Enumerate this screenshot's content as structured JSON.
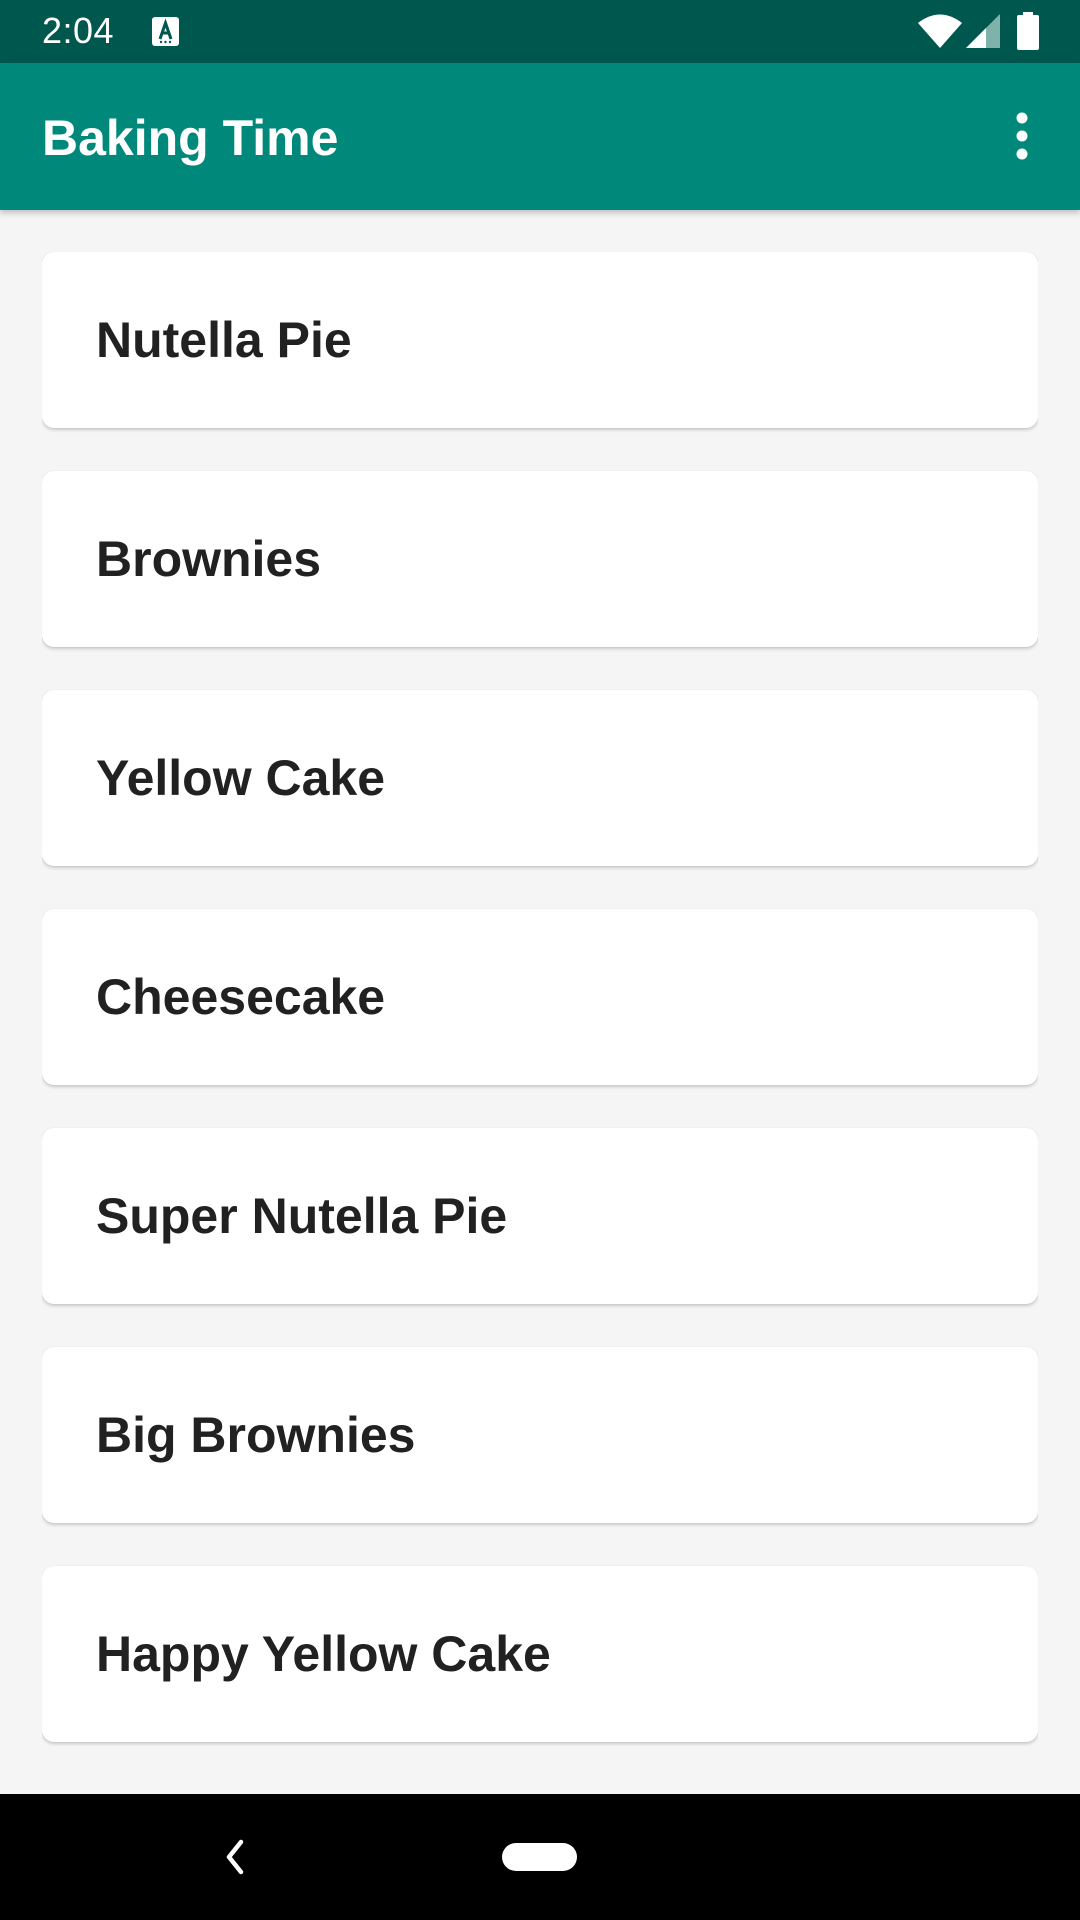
{
  "status_bar": {
    "time": "2:04",
    "notification_icon": "accessibility-a-icon",
    "wifi_icon": "wifi-icon",
    "signal_icon": "cell-signal-icon",
    "battery_icon": "battery-icon"
  },
  "app_bar": {
    "title": "Baking Time",
    "overflow_icon": "more-vert-icon"
  },
  "recipes": [
    {
      "name": "Nutella Pie"
    },
    {
      "name": "Brownies"
    },
    {
      "name": "Yellow Cake"
    },
    {
      "name": "Cheesecake"
    },
    {
      "name": "Super Nutella Pie"
    },
    {
      "name": "Big Brownies"
    },
    {
      "name": "Happy Yellow Cake"
    }
  ],
  "nav_bar": {
    "back_icon": "back-chevron-icon",
    "home_icon": "home-pill-icon"
  },
  "colors": {
    "status_bar": "#00574e",
    "primary": "#00897b",
    "background": "#f5f5f5",
    "card": "#ffffff",
    "text": "#212121"
  }
}
